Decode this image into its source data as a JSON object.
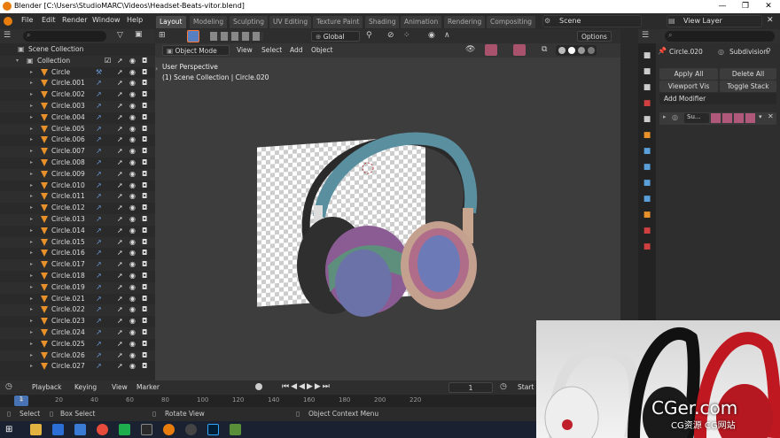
{
  "window": {
    "title": "Blender [C:\\Users\\StudioMARC\\Videos\\Headset-Beats-vitor.blend]",
    "min": "—",
    "max": "❐",
    "close": "✕"
  },
  "menus": [
    "File",
    "Edit",
    "Render",
    "Window",
    "Help"
  ],
  "workspaces": [
    "Layout",
    "Modeling",
    "Sculpting",
    "UV Editing",
    "Texture Paint",
    "Shading",
    "Animation",
    "Rendering",
    "Compositing"
  ],
  "scene": "Scene",
  "view_layer": "View Layer",
  "outliner": {
    "root": "Scene Collection",
    "collection": "Collection",
    "items": [
      "Circle",
      "Circle.001",
      "Circle.002",
      "Circle.003",
      "Circle.004",
      "Circle.005",
      "Circle.006",
      "Circle.007",
      "Circle.008",
      "Circle.009",
      "Circle.010",
      "Circle.011",
      "Circle.012",
      "Circle.013",
      "Circle.014",
      "Circle.015",
      "Circle.016",
      "Circle.017",
      "Circle.018",
      "Circle.019",
      "Circle.021",
      "Circle.022",
      "Circle.023",
      "Circle.024",
      "Circle.025",
      "Circle.026",
      "Circle.027"
    ]
  },
  "viewport": {
    "transform": "Global",
    "options": "Options",
    "mode": "Object Mode",
    "menu": [
      "View",
      "Select",
      "Add",
      "Object"
    ],
    "overlay_line1": "User Perspective",
    "overlay_line2": "(1) Scene Collection | Circle.020"
  },
  "properties": {
    "object": "Circle.020",
    "modifier": "Subdivision",
    "apply_all": "Apply All",
    "delete_all": "Delete All",
    "viewport_vis": "Viewport Vis",
    "toggle_stack": "Toggle Stack",
    "add_modifier": "Add Modifier",
    "modifier_short": "Su..."
  },
  "timeline": {
    "playback": "Playback",
    "keying": "Keying",
    "view": "View",
    "marker": "Marker",
    "frame": "1",
    "start": "Start",
    "ticks": [
      "0",
      "20",
      "40",
      "60",
      "80",
      "100",
      "120",
      "140",
      "160",
      "180",
      "200",
      "220"
    ]
  },
  "status": {
    "select": "Select",
    "box_select": "Box Select",
    "rotate_view": "Rotate View",
    "context_menu": "Object Context Menu"
  },
  "watermark": {
    "main": "CGer.com",
    "sub": "CG资源 CG网站"
  },
  "colors": {
    "accent": "#e8902a",
    "active_tab": "#494949",
    "title_bg": "#ffffff"
  }
}
